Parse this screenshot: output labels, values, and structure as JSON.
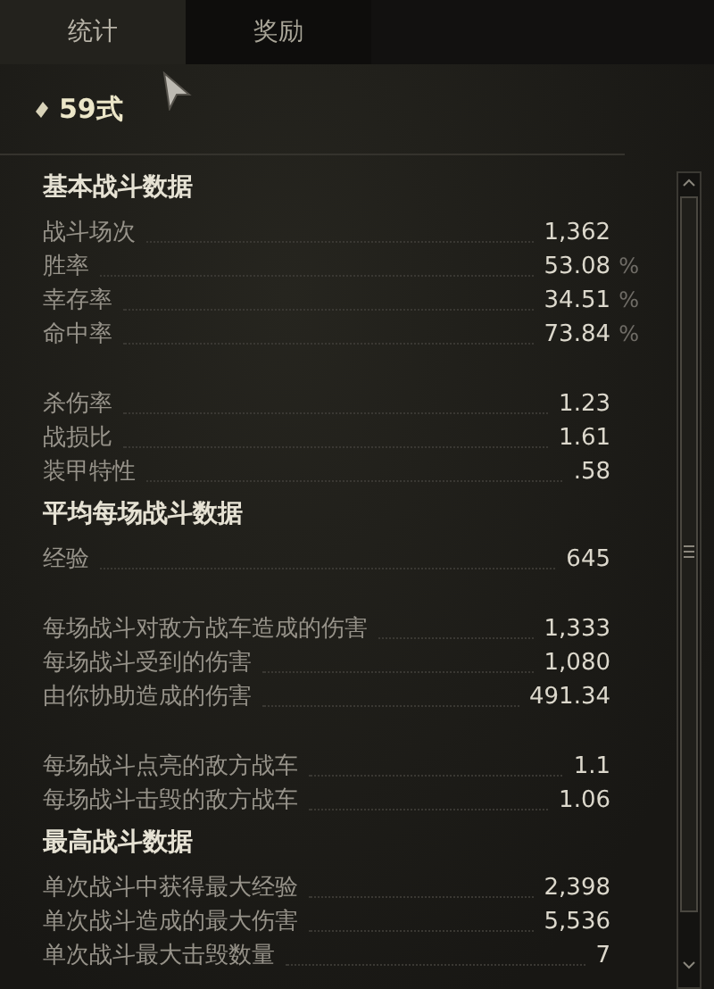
{
  "tabs": [
    {
      "label": "统计",
      "selected": true
    },
    {
      "label": "奖励",
      "selected": false
    }
  ],
  "vehicle": {
    "name": "59式"
  },
  "sections": [
    {
      "title": "基本战斗数据",
      "groups": [
        [
          {
            "label": "战斗场次",
            "value": "1,362"
          },
          {
            "label": "胜率",
            "value": "53.08",
            "unit": "%"
          },
          {
            "label": "幸存率",
            "value": "34.51",
            "unit": "%"
          },
          {
            "label": "命中率",
            "value": "73.84",
            "unit": "%"
          }
        ],
        [
          {
            "label": "杀伤率",
            "value": "1.23"
          },
          {
            "label": "战损比",
            "value": "1.61"
          },
          {
            "label": "装甲特性",
            "value": ".58"
          }
        ]
      ]
    },
    {
      "title": "平均每场战斗数据",
      "groups": [
        [
          {
            "label": "经验",
            "value": "645"
          }
        ],
        [
          {
            "label": "每场战斗对敌方战车造成的伤害",
            "value": "1,333"
          },
          {
            "label": "每场战斗受到的伤害",
            "value": "1,080"
          },
          {
            "label": "由你协助造成的伤害",
            "value": "491.34"
          }
        ],
        [
          {
            "label": "每场战斗点亮的敌方战车",
            "value": "1.1"
          },
          {
            "label": "每场战斗击毁的敌方战车",
            "value": "1.06"
          }
        ]
      ]
    },
    {
      "title": "最高战斗数据",
      "groups": [
        [
          {
            "label": "单次战斗中获得最大经验",
            "value": "2,398"
          },
          {
            "label": "单次战斗造成的最大伤害",
            "value": "5,536"
          },
          {
            "label": "单次战斗最大击毁数量",
            "value": "7"
          }
        ]
      ]
    }
  ]
}
